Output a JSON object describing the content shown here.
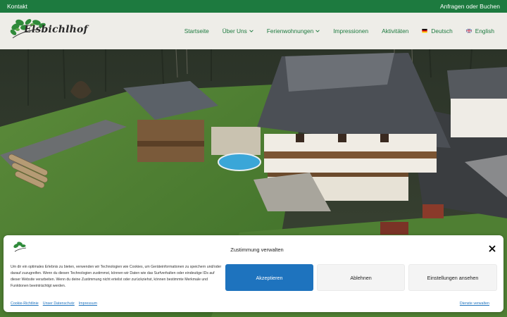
{
  "topbar": {
    "left_link": "Kontakt",
    "right_link": "Anfragen oder Buchen"
  },
  "header": {
    "logo_text": "Elsbichlhof",
    "nav": [
      {
        "label": "Startseite"
      },
      {
        "label": "Über Uns",
        "has_dropdown": true
      },
      {
        "label": "Ferienwohnungen",
        "has_dropdown": true
      },
      {
        "label": "Impressionen"
      },
      {
        "label": "Aktivitäten"
      },
      {
        "label": "Deutsch",
        "flag": "de-flag-icon"
      },
      {
        "label": "English",
        "flag": "gb-flag-icon"
      }
    ]
  },
  "cookie_banner": {
    "title": "Zustimmung verwalten",
    "text": "Um dir ein optimales Erlebnis zu bieten, verwenden wir Technologien wie Cookies, um Geräteinformationen zu speichern und/oder darauf zuzugreifen. Wenn du diesen Technologien zustimmst, können wir Daten wie das Surfverhalten oder eindeutige IDs auf dieser Website verarbeiten. Wenn du deine Zustimmung nicht erteilst oder zurückziehst, können bestimmte Merkmale und Funktionen beeinträchtigt werden.",
    "accept_label": "Akzeptieren",
    "deny_label": "Ablehnen",
    "settings_label": "Einstellungen ansehen",
    "links": [
      "Cookie-Richtlinie",
      "Unser Datenschutz",
      "Impressum"
    ],
    "manage_link": "Dienste verwalten"
  },
  "colors": {
    "brand_green": "#1d7a3f",
    "accept_blue": "#1e73be",
    "header_bg": "#eeede8"
  }
}
